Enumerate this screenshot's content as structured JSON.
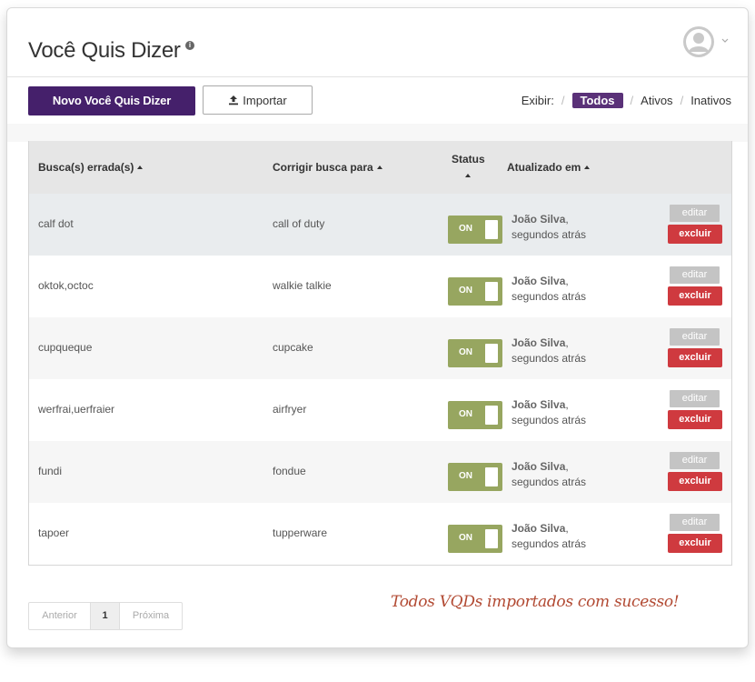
{
  "header": {
    "title": "Você Quis Dizer",
    "info_icon": "info-icon",
    "avatar_icon": "user-avatar-icon"
  },
  "toolbar": {
    "new_label": "Novo Você Quis Dizer",
    "import_label": "Importar",
    "filter_label": "Exibir:",
    "filters": [
      "Todos",
      "Ativos",
      "Inativos"
    ],
    "active_filter": "Todos"
  },
  "table": {
    "columns": [
      "Busca(s) errada(s)",
      "Corrigir busca para",
      "Status",
      "Atualizado em"
    ],
    "rows": [
      {
        "wrong": "calf dot",
        "correct": "call of duty",
        "status": "ON",
        "user": "João Silva",
        "when": "segundos atrás"
      },
      {
        "wrong": "oktok,octoc",
        "correct": "walkie talkie",
        "status": "ON",
        "user": "João Silva",
        "when": "segundos atrás"
      },
      {
        "wrong": "cupqueque",
        "correct": "cupcake",
        "status": "ON",
        "user": "João Silva",
        "when": "segundos atrás"
      },
      {
        "wrong": "werfrai,uerfraier",
        "correct": "airfryer",
        "status": "ON",
        "user": "João Silva",
        "when": "segundos atrás"
      },
      {
        "wrong": "fundi",
        "correct": "fondue",
        "status": "ON",
        "user": "João Silva",
        "when": "segundos atrás"
      },
      {
        "wrong": "tapoer",
        "correct": "tupperware",
        "status": "ON",
        "user": "João Silva",
        "when": "segundos atrás"
      }
    ],
    "edit_label": "editar",
    "delete_label": "excluir"
  },
  "pagination": {
    "prev": "Anterior",
    "current": "1",
    "next": "Próxima"
  },
  "toast": "Todos VQDs importados com sucesso!",
  "colors": {
    "primary": "#45206b",
    "toggle_on": "#97a660",
    "delete": "#cf3a3f",
    "toast": "#b24a33"
  }
}
